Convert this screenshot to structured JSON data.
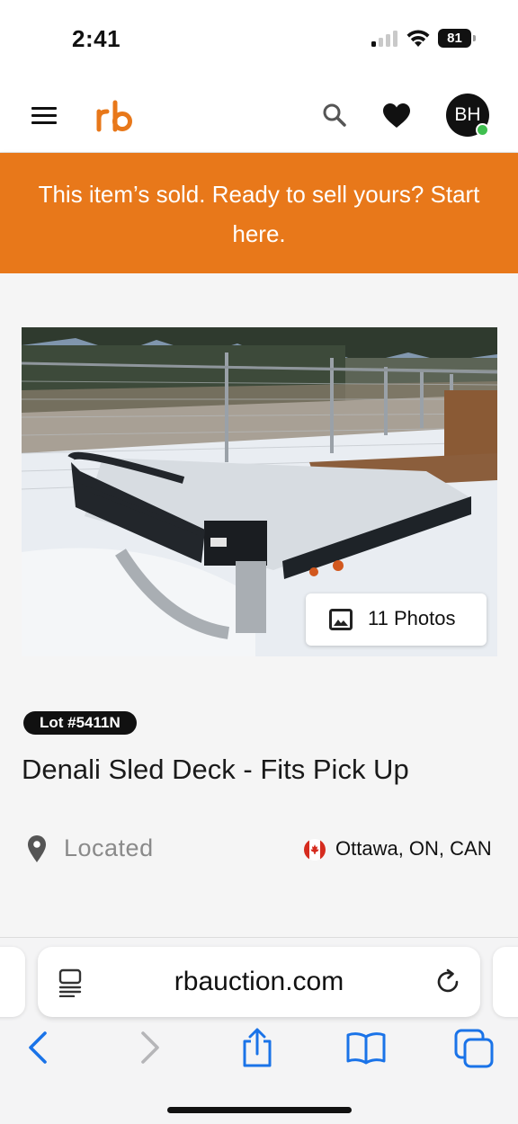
{
  "status_bar": {
    "time": "2:41",
    "battery": "81",
    "icons": [
      "cellular-signal-icon",
      "wifi-icon",
      "battery-icon"
    ]
  },
  "header": {
    "menu_icon": "hamburger-menu-icon",
    "logo_text": "rb",
    "search_icon": "search-icon",
    "favorites_icon": "heart-icon",
    "avatar_initials": "BH",
    "brand_color": "#e8781a"
  },
  "banner": {
    "text": "This item’s sold. Ready to sell yours? Start here.",
    "background": "#e8781a"
  },
  "listing": {
    "photo_alt": "Denali sled deck on snowy ground behind a chain-link fence",
    "photos_button_label": "11 Photos",
    "lot": "Lot #5411N",
    "title": "Denali Sled Deck - Fits Pick Up",
    "located_label": "Located",
    "location": "Ottawa, ON, CAN"
  },
  "browser": {
    "url": "rbauction.com",
    "icons": [
      "reader-mode-icon",
      "reload-icon",
      "back-icon",
      "forward-icon",
      "share-icon",
      "bookmarks-icon",
      "tabs-icon"
    ]
  }
}
